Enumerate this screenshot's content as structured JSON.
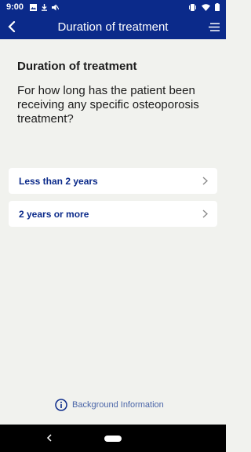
{
  "status_bar": {
    "time": "9:00",
    "left_icons": [
      "image-icon",
      "download-icon",
      "mute-icon"
    ],
    "right_icons": [
      "vibrate-icon",
      "wifi-icon",
      "battery-icon"
    ]
  },
  "app_bar": {
    "title": "Duration of treatment",
    "back_icon": "chevron-left-icon",
    "menu_icon": "menu-icon"
  },
  "question": {
    "title": "Duration of treatment",
    "text": "For how long has the patient been receiving any specific osteoporosis treatment?"
  },
  "options": [
    {
      "label": "Less than 2 years"
    },
    {
      "label": "2 years or more"
    }
  ],
  "background_info": {
    "label": "Background Information",
    "icon": "info-icon"
  },
  "colors": {
    "primary": "#0b2a8a",
    "background": "#f1f2ee",
    "card": "#ffffff",
    "link": "#4a65a8"
  }
}
